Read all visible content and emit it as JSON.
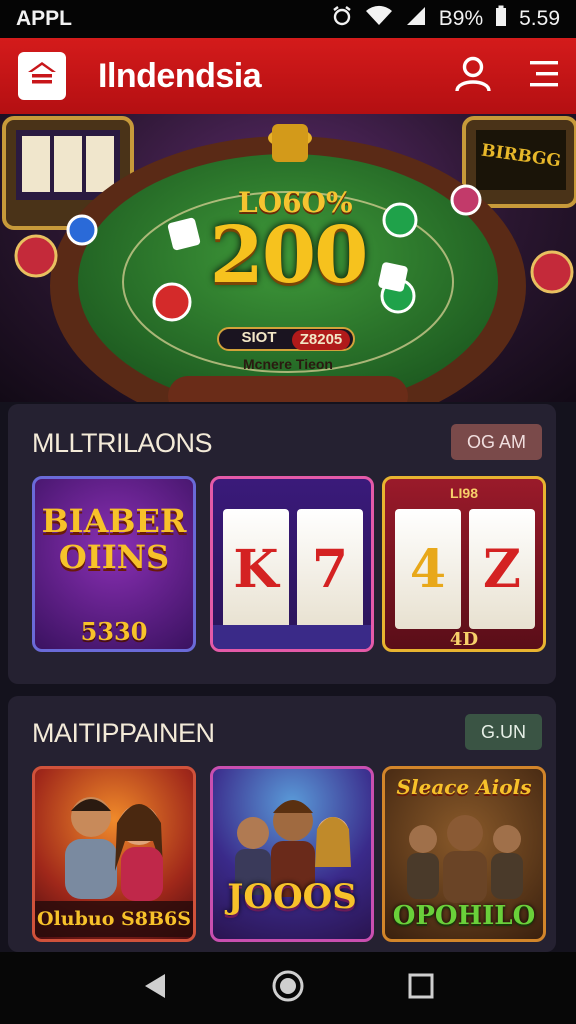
{
  "status_bar": {
    "carrier": "APPL",
    "battery": "B9%",
    "time": "5.59"
  },
  "header": {
    "brand": "Ilndendsia"
  },
  "hero": {
    "top_banner": "LO6O%",
    "jackpot": "200",
    "chip_left": "SIOT",
    "chip_right": "Z8205",
    "subtitle": "Mcnere Tieon",
    "right_screen": "BIRBGG"
  },
  "sections": [
    {
      "title": "MLLTRILAONS",
      "button": "OG AM",
      "button_color": "#7a4a4a",
      "tiles": [
        {
          "title": "BIABER OIINS",
          "footer": "5330",
          "border": "#6a6ad8"
        },
        {
          "title": "K7",
          "footer": "",
          "top": "",
          "border": "#e45aa8"
        },
        {
          "title": "4Z",
          "footer": "4D",
          "top": "LI98",
          "border": "#e8b430"
        }
      ]
    },
    {
      "title": "MAITIPPAINEN",
      "button": "G.UN",
      "button_color": "#3a5444",
      "tiles": [
        {
          "title": "Olubuo S8B6S",
          "border": "#d0523b"
        },
        {
          "title": "JOOOS",
          "border": "#c94fb0"
        },
        {
          "title": "Sleace Aiols",
          "footer": "OPOHILO",
          "border": "#d2852a"
        }
      ]
    }
  ]
}
